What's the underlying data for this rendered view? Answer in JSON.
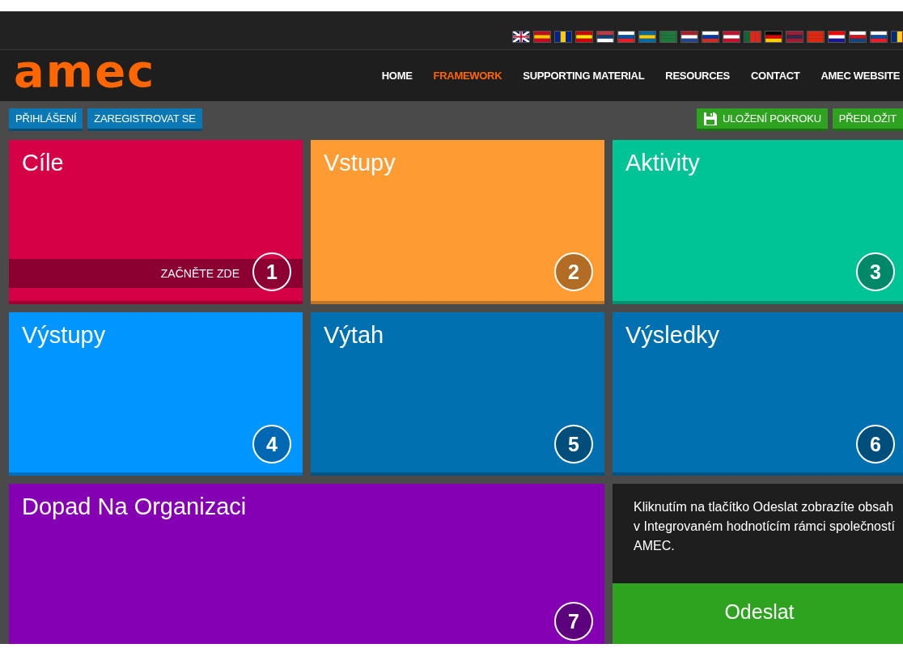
{
  "header": {
    "logo": "amec",
    "nav": [
      {
        "label": "HOME",
        "selected": false
      },
      {
        "label": "FRAMEWORK",
        "selected": true
      },
      {
        "label": "SUPPORTING MATERIAL",
        "selected": false
      },
      {
        "label": "RESOURCES",
        "selected": false
      },
      {
        "label": "CONTACT",
        "selected": false
      },
      {
        "label": "AMEC WEBSITE",
        "selected": false
      }
    ]
  },
  "toolbar": {
    "left_buttons": [
      "PŘIHLÁŠENÍ",
      "ZAREGISTROVAT SE"
    ],
    "right_buttons": [
      {
        "label": "ULOŽENÍ POKROKU",
        "kind": "save"
      },
      {
        "label": "PŘEDLOŽIT",
        "kind": "plain"
      }
    ]
  },
  "tiles": [
    {
      "title": "Cíle",
      "number": "1",
      "color": "#d50046",
      "banner": "ZAČNĚTE ZDE"
    },
    {
      "title": "Vstupy",
      "number": "2",
      "color": "#ff9b33"
    },
    {
      "title": "Aktivity",
      "number": "3",
      "color": "#00c496"
    },
    {
      "title": "Výstupy",
      "number": "4",
      "color": "#0095ff"
    },
    {
      "title": "Výtah",
      "number": "5",
      "color": "#0070b0"
    },
    {
      "title": "Výsledky",
      "number": "6",
      "color": "#0070b0"
    },
    {
      "title": "Dopad Na Organizaci",
      "number": "7",
      "color": "#8600b3"
    }
  ],
  "submit_panel": {
    "text": "Kliknutím na tlačítko Odeslat zobrazíte obsah v Integrovaném hodnotícím rámci společností AMEC.",
    "button": "Odeslat"
  }
}
